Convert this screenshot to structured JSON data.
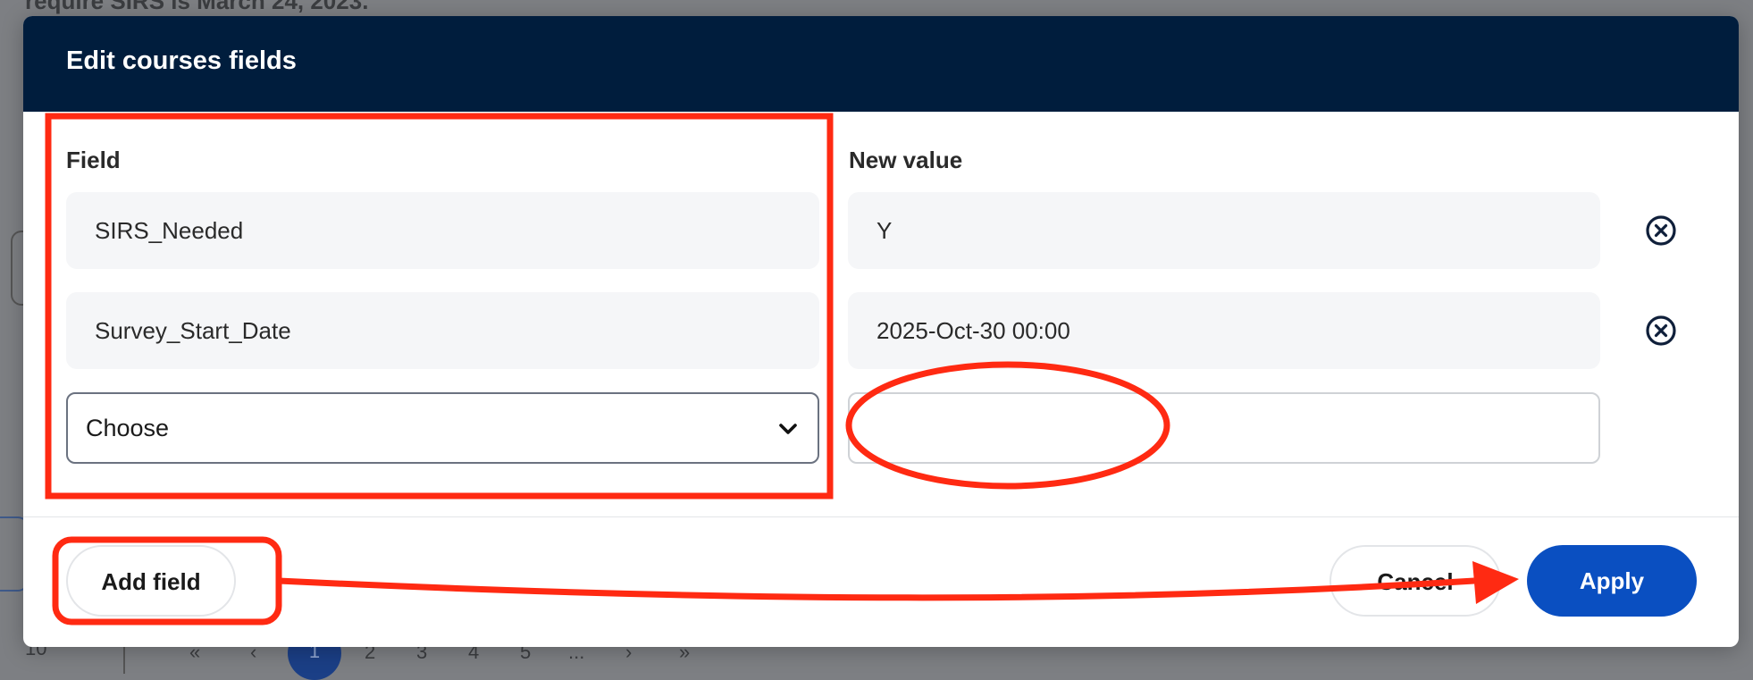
{
  "background": {
    "notice_text": "require SIRS is March 24, 2023.",
    "pagination": {
      "page_size": "10",
      "first": "«",
      "prev": "‹",
      "pages": [
        "1",
        "2",
        "3",
        "4",
        "5",
        "..."
      ],
      "next": "›",
      "last": "»",
      "active_page": "1"
    }
  },
  "modal": {
    "title": "Edit courses fields",
    "columns": {
      "field": "Field",
      "new_value": "New value"
    },
    "rows": [
      {
        "field": "SIRS_Needed",
        "value": "Y"
      },
      {
        "field": "Survey_Start_Date",
        "value": "2025-Oct-30 00:00"
      }
    ],
    "new_row": {
      "select_value": "Choose",
      "value": ""
    },
    "buttons": {
      "add_field": "Add field",
      "cancel": "Cancel",
      "apply": "Apply"
    }
  },
  "colors": {
    "header_bg": "#001d3d",
    "primary": "#0a4fc1",
    "annotation": "#ff2a12"
  },
  "icons": {
    "remove": "circle-x-icon",
    "dropdown": "chevron-down-icon"
  }
}
